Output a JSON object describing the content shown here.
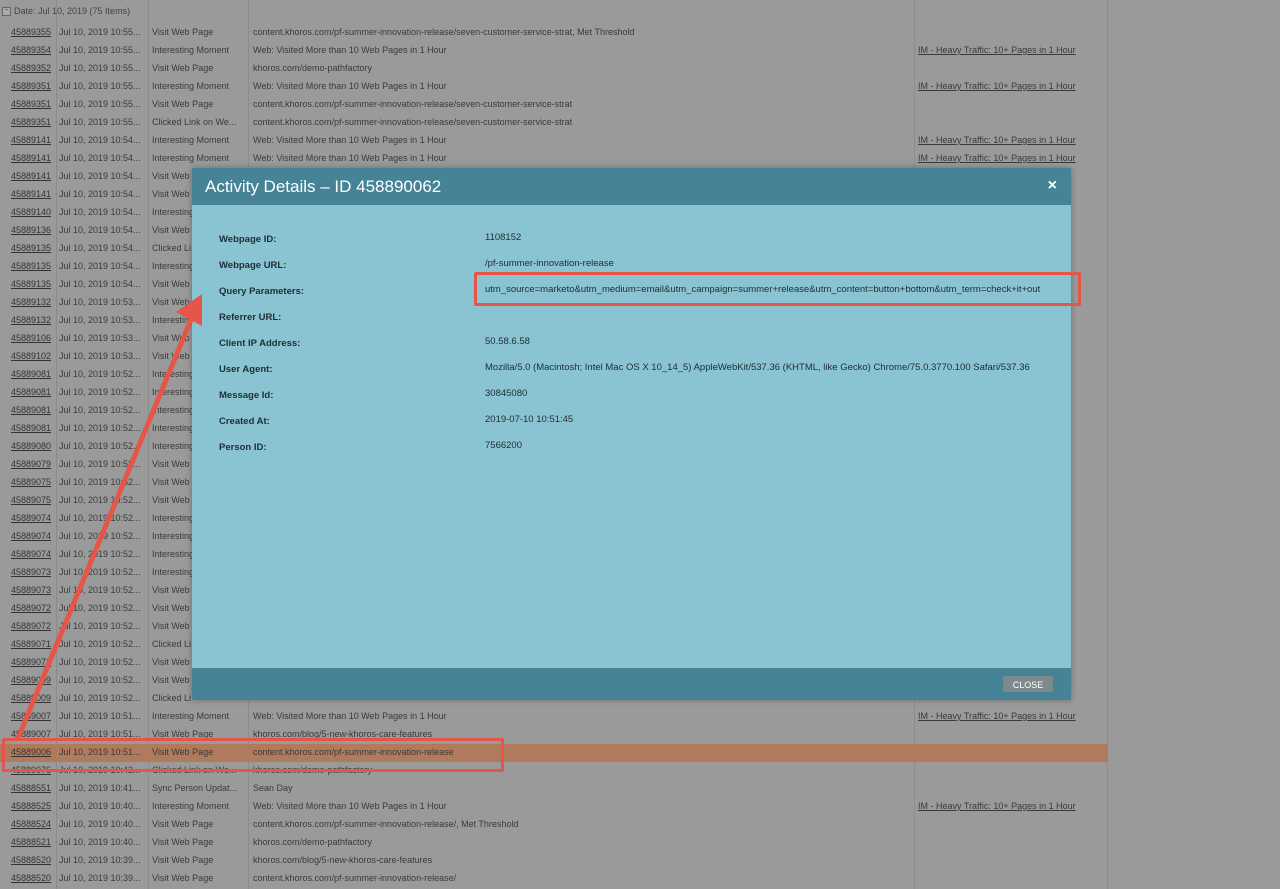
{
  "group_header": "Date: Jul 10, 2019 (75 Items)",
  "rows": [
    {
      "id": "45889355",
      "date": "Jul 10, 2019 10:55...",
      "type": "Visit Web Page",
      "detail": "content.khoros.com/pf-summer-innovation-release/seven-customer-service-strat, Met Threshold",
      "campaign": ""
    },
    {
      "id": "45889354",
      "date": "Jul 10, 2019 10:55...",
      "type": "Interesting Moment",
      "detail": "Web: Visited More than 10 Web Pages in 1 Hour",
      "campaign": "IM - Heavy Traffic: 10+ Pages in 1 Hour"
    },
    {
      "id": "45889352",
      "date": "Jul 10, 2019 10:55...",
      "type": "Visit Web Page",
      "detail": "khoros.com/demo-pathfactory",
      "campaign": ""
    },
    {
      "id": "45889351",
      "date": "Jul 10, 2019 10:55...",
      "type": "Interesting Moment",
      "detail": "Web: Visited More than 10 Web Pages in 1 Hour",
      "campaign": "IM - Heavy Traffic: 10+ Pages in 1 Hour"
    },
    {
      "id": "45889351",
      "date": "Jul 10, 2019 10:55...",
      "type": "Visit Web Page",
      "detail": "content.khoros.com/pf-summer-innovation-release/seven-customer-service-strat",
      "campaign": ""
    },
    {
      "id": "45889351",
      "date": "Jul 10, 2019 10:55...",
      "type": "Clicked Link on We...",
      "detail": "content.khoros.com/pf-summer-innovation-release/seven-customer-service-strat",
      "campaign": ""
    },
    {
      "id": "45889141",
      "date": "Jul 10, 2019 10:54...",
      "type": "Interesting Moment",
      "detail": "Web: Visited More than 10 Web Pages in 1 Hour",
      "campaign": "IM - Heavy Traffic: 10+ Pages in 1 Hour"
    },
    {
      "id": "45889141",
      "date": "Jul 10, 2019 10:54...",
      "type": "Interesting Moment",
      "detail": "Web: Visited More than 10 Web Pages in 1 Hour",
      "campaign": "IM - Heavy Traffic: 10+ Pages in 1 Hour"
    },
    {
      "id": "45889141",
      "date": "Jul 10, 2019 10:54...",
      "type": "Visit Web",
      "detail": "",
      "campaign": ""
    },
    {
      "id": "45889141",
      "date": "Jul 10, 2019 10:54...",
      "type": "Visit Web",
      "detail": "",
      "campaign": ""
    },
    {
      "id": "45889140",
      "date": "Jul 10, 2019 10:54...",
      "type": "Interesting",
      "detail": "",
      "campaign": ""
    },
    {
      "id": "45889136",
      "date": "Jul 10, 2019 10:54...",
      "type": "Visit Web",
      "detail": "",
      "campaign": ""
    },
    {
      "id": "45889135",
      "date": "Jul 10, 2019 10:54...",
      "type": "Clicked Li",
      "detail": "",
      "campaign": ""
    },
    {
      "id": "45889135",
      "date": "Jul 10, 2019 10:54...",
      "type": "Interesting",
      "detail": "",
      "campaign": ""
    },
    {
      "id": "45889135",
      "date": "Jul 10, 2019 10:54...",
      "type": "Visit Web",
      "detail": "",
      "campaign": ""
    },
    {
      "id": "45889132",
      "date": "Jul 10, 2019 10:53...",
      "type": "Visit Web",
      "detail": "",
      "campaign": ""
    },
    {
      "id": "45889132",
      "date": "Jul 10, 2019 10:53...",
      "type": "Interesting",
      "detail": "",
      "campaign": ""
    },
    {
      "id": "45889106",
      "date": "Jul 10, 2019 10:53...",
      "type": "Visit Web",
      "detail": "",
      "campaign": ""
    },
    {
      "id": "45889102",
      "date": "Jul 10, 2019 10:53...",
      "type": "Visit Web",
      "detail": "",
      "campaign": ""
    },
    {
      "id": "45889081",
      "date": "Jul 10, 2019 10:52...",
      "type": "Interesting",
      "detail": "",
      "campaign": ""
    },
    {
      "id": "45889081",
      "date": "Jul 10, 2019 10:52...",
      "type": "Interesting",
      "detail": "",
      "campaign": ""
    },
    {
      "id": "45889081",
      "date": "Jul 10, 2019 10:52...",
      "type": "Interesting",
      "detail": "",
      "campaign": ""
    },
    {
      "id": "45889081",
      "date": "Jul 10, 2019 10:52...",
      "type": "Interesting",
      "detail": "",
      "campaign": ""
    },
    {
      "id": "45889080",
      "date": "Jul 10, 2019 10:52...",
      "type": "Interesting",
      "detail": "",
      "campaign": ""
    },
    {
      "id": "45889079",
      "date": "Jul 10, 2019 10:52...",
      "type": "Visit Web",
      "detail": "",
      "campaign": ""
    },
    {
      "id": "45889075",
      "date": "Jul 10, 2019 10:52...",
      "type": "Visit Web",
      "detail": "",
      "campaign": ""
    },
    {
      "id": "45889075",
      "date": "Jul 10, 2019 10:52...",
      "type": "Visit Web",
      "detail": "",
      "campaign": ""
    },
    {
      "id": "45889074",
      "date": "Jul 10, 2019 10:52...",
      "type": "Interesting",
      "detail": "",
      "campaign": ""
    },
    {
      "id": "45889074",
      "date": "Jul 10, 2019 10:52...",
      "type": "Interesting",
      "detail": "",
      "campaign": ""
    },
    {
      "id": "45889074",
      "date": "Jul 10, 2019 10:52...",
      "type": "Interesting",
      "detail": "",
      "campaign": ""
    },
    {
      "id": "45889073",
      "date": "Jul 10, 2019 10:52...",
      "type": "Interesting",
      "detail": "",
      "campaign": ""
    },
    {
      "id": "45889073",
      "date": "Jul 10, 2019 10:52...",
      "type": "Visit Web",
      "detail": "",
      "campaign": ""
    },
    {
      "id": "45889072",
      "date": "Jul 10, 2019 10:52...",
      "type": "Visit Web",
      "detail": "",
      "campaign": ""
    },
    {
      "id": "45889072",
      "date": "Jul 10, 2019 10:52...",
      "type": "Visit Web",
      "detail": "",
      "campaign": ""
    },
    {
      "id": "45889071",
      "date": "Jul 10, 2019 10:52...",
      "type": "Clicked Li",
      "detail": "",
      "campaign": ""
    },
    {
      "id": "45889071",
      "date": "Jul 10, 2019 10:52...",
      "type": "Visit Web",
      "detail": "",
      "campaign": ""
    },
    {
      "id": "45889009",
      "date": "Jul 10, 2019 10:52...",
      "type": "Visit Web",
      "detail": "",
      "campaign": ""
    },
    {
      "id": "45889009",
      "date": "Jul 10, 2019 10:52...",
      "type": "Clicked Li",
      "detail": "",
      "campaign": ""
    },
    {
      "id": "45889007",
      "date": "Jul 10, 2019 10:51...",
      "type": "Interesting Moment",
      "detail": "Web: Visited More than 10 Web Pages in 1 Hour",
      "campaign": "IM - Heavy Traffic: 10+ Pages in 1 Hour"
    },
    {
      "id": "45889007",
      "date": "Jul 10, 2019 10:51...",
      "type": "Visit Web Page",
      "detail": "khoros.com/blog/5-new-khoros-care-features",
      "campaign": ""
    },
    {
      "id": "45889006",
      "date": "Jul 10, 2019 10:51...",
      "type": "Visit Web Page",
      "detail": "content.khoros.com/pf-summer-innovation-release",
      "campaign": "",
      "highlight": true
    },
    {
      "id": "45889076",
      "date": "Jul 10, 2019 10:42...",
      "type": "Clicked Link on We...",
      "detail": "khoros.com/demo-pathfactory",
      "campaign": ""
    },
    {
      "id": "45888551",
      "date": "Jul 10, 2019 10:41...",
      "type": "Sync Person Updat...",
      "detail": "Sean Day",
      "campaign": ""
    },
    {
      "id": "45888525",
      "date": "Jul 10, 2019 10:40...",
      "type": "Interesting Moment",
      "detail": "Web: Visited More than 10 Web Pages in 1 Hour",
      "campaign": "IM - Heavy Traffic: 10+ Pages in 1 Hour"
    },
    {
      "id": "45888524",
      "date": "Jul 10, 2019 10:40...",
      "type": "Visit Web Page",
      "detail": "content.khoros.com/pf-summer-innovation-release/, Met Threshold",
      "campaign": ""
    },
    {
      "id": "45888521",
      "date": "Jul 10, 2019 10:40...",
      "type": "Visit Web Page",
      "detail": "khoros.com/demo-pathfactory",
      "campaign": ""
    },
    {
      "id": "45888520",
      "date": "Jul 10, 2019 10:39...",
      "type": "Visit Web Page",
      "detail": "khoros.com/blog/5-new-khoros-care-features",
      "campaign": ""
    },
    {
      "id": "45888520",
      "date": "Jul 10, 2019 10:39...",
      "type": "Visit Web Page",
      "detail": "content.khoros.com/pf-summer-innovation-release/",
      "campaign": ""
    }
  ],
  "modal": {
    "title": "Activity Details – ID 458890062",
    "close_x": "×",
    "fields": [
      {
        "label": "Webpage ID:",
        "value": "1108152"
      },
      {
        "label": "Webpage URL:",
        "value": "/pf-summer-innovation-release"
      },
      {
        "label": "Query Parameters:",
        "value": "utm_source=marketo&utm_medium=email&utm_campaign=summer+release&utm_content=button+bottom&utm_term=check+it+out"
      },
      {
        "label": "Referrer URL:",
        "value": ""
      },
      {
        "label": "Client IP Address:",
        "value": "50.58.6.58"
      },
      {
        "label": "User Agent:",
        "value": "Mozilla/5.0 (Macintosh; Intel Mac OS X 10_14_5) AppleWebKit/537.36 (KHTML, like Gecko) Chrome/75.0.3770.100 Safari/537.36"
      },
      {
        "label": "Message Id:",
        "value": "30845080"
      },
      {
        "label": "Created At:",
        "value": "2019-07-10 10:51:45"
      },
      {
        "label": "Person ID:",
        "value": "7566200"
      }
    ],
    "close_button": "CLOSE"
  },
  "colors": {
    "modal_body": "#8ac3d2",
    "modal_header": "#468396",
    "annotation": "#e5564a",
    "row_highlight": "#b07a5c"
  }
}
